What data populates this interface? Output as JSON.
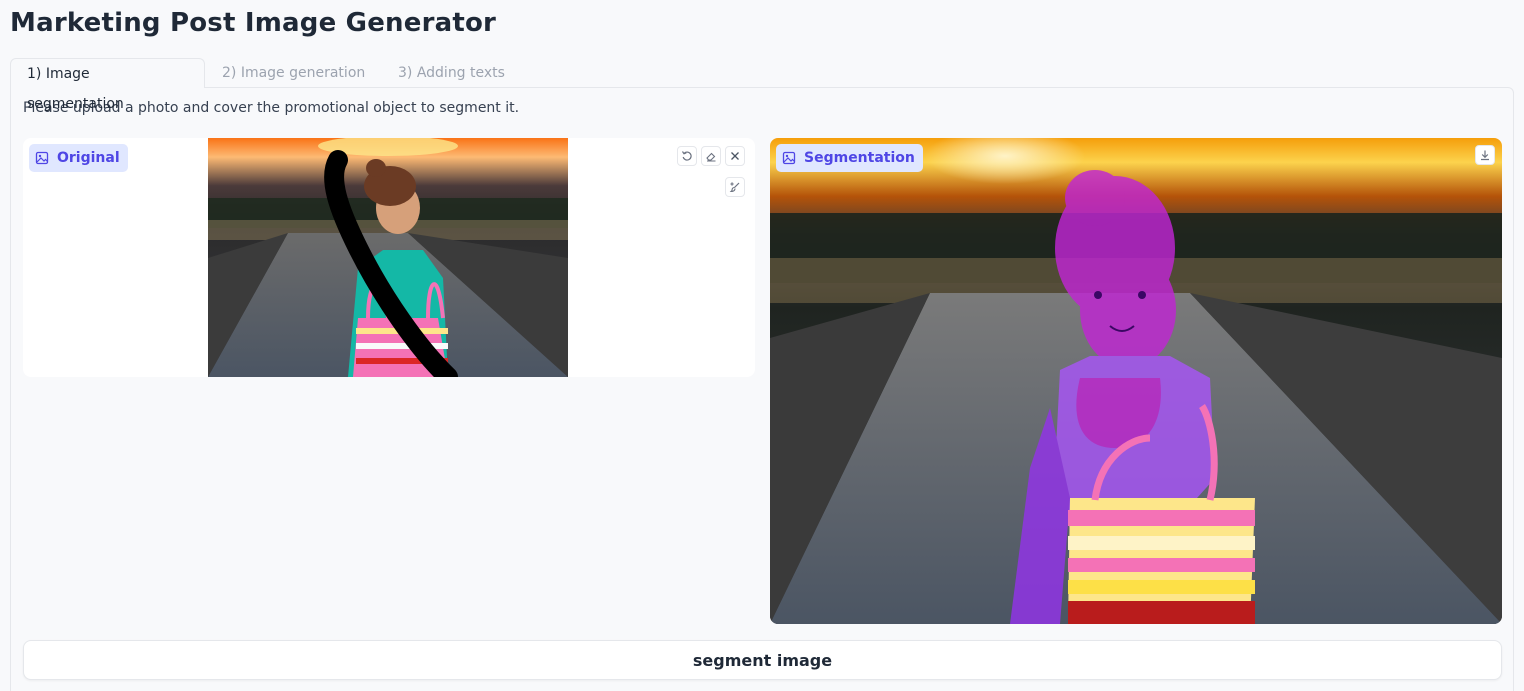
{
  "app": {
    "title": "Marketing Post Image Generator"
  },
  "tabs": [
    {
      "label": "1) Image segmentation",
      "active": true
    },
    {
      "label": "2) Image generation",
      "active": false
    },
    {
      "label": "3) Adding texts",
      "active": false
    }
  ],
  "panel": {
    "instructions": "Please upload a photo and cover the promotional object to segment it.",
    "original": {
      "label": "Original",
      "label_icon": "image-icon",
      "tools": [
        "undo-icon",
        "eraser-icon",
        "close-icon",
        "brush-icon"
      ]
    },
    "segmentation": {
      "label": "Segmentation",
      "label_icon": "image-icon",
      "tools": [
        "download-icon"
      ]
    },
    "segment_button": "segment image"
  },
  "colors": {
    "accent": "#4f46e5",
    "badge_bg": "#e0e7ff",
    "mask": "#c026d3"
  }
}
